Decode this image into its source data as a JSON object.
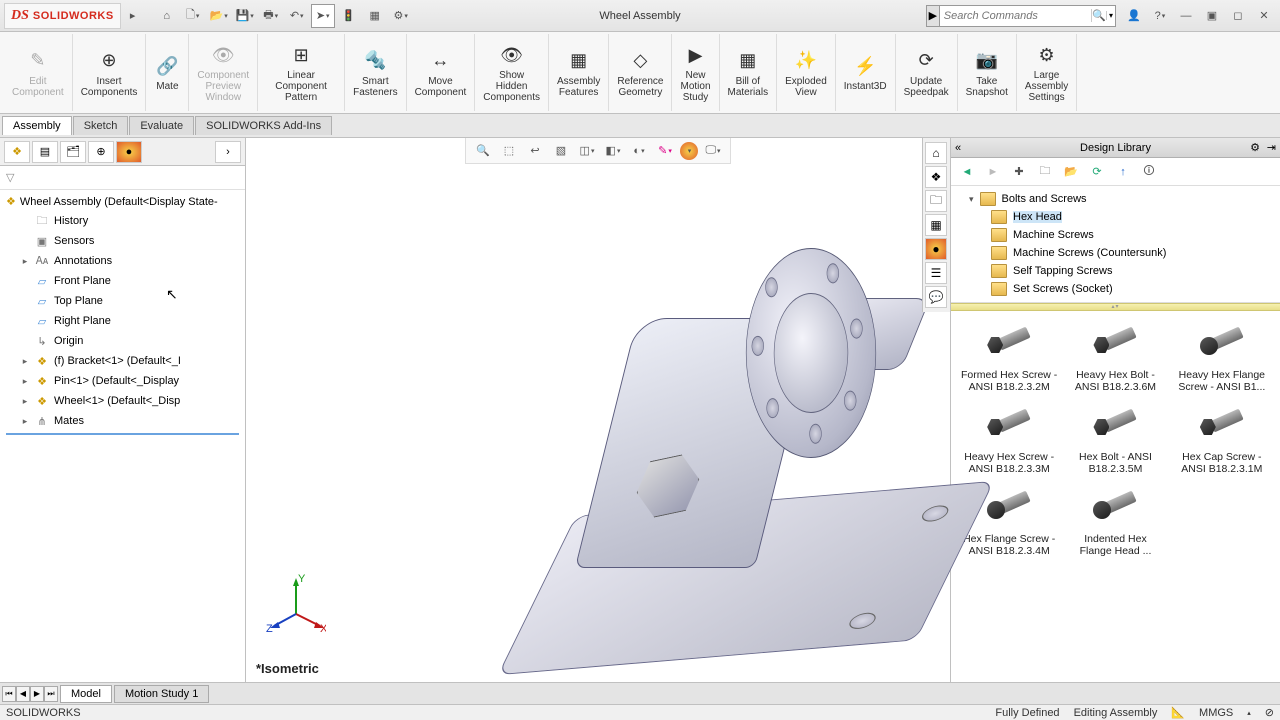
{
  "app": {
    "brand_ds": "DS",
    "brand_sw": "SOLIDWORKS",
    "doc_title": "Wheel Assembly"
  },
  "search": {
    "placeholder": "Search Commands"
  },
  "ribbon": [
    {
      "label": "Edit\nComponent",
      "dim": true
    },
    {
      "label": "Insert\nComponents"
    },
    {
      "label": "Mate"
    },
    {
      "label": "Component\nPreview\nWindow",
      "dim": true
    },
    {
      "label": "Linear Component\nPattern"
    },
    {
      "label": "Smart\nFasteners"
    },
    {
      "label": "Move\nComponent"
    },
    {
      "label": "Show\nHidden\nComponents"
    },
    {
      "label": "Assembly\nFeatures"
    },
    {
      "label": "Reference\nGeometry"
    },
    {
      "label": "New\nMotion\nStudy"
    },
    {
      "label": "Bill of\nMaterials"
    },
    {
      "label": "Exploded\nView"
    },
    {
      "label": "Instant3D"
    },
    {
      "label": "Update\nSpeedpak"
    },
    {
      "label": "Take\nSnapshot"
    },
    {
      "label": "Large\nAssembly\nSettings"
    }
  ],
  "doc_tabs": [
    "Assembly",
    "Sketch",
    "Evaluate",
    "SOLIDWORKS Add-Ins"
  ],
  "tree": {
    "root": "Wheel Assembly  (Default<Display State-",
    "items": [
      {
        "label": "History",
        "icon": "folder"
      },
      {
        "label": "Sensors",
        "icon": "sensor"
      },
      {
        "label": "Annotations",
        "icon": "note",
        "exp": true
      },
      {
        "label": "Front Plane",
        "icon": "plane"
      },
      {
        "label": "Top Plane",
        "icon": "plane"
      },
      {
        "label": "Right Plane",
        "icon": "plane"
      },
      {
        "label": "Origin",
        "icon": "origin"
      },
      {
        "label": "(f) Bracket<1> (Default<<Default>_I",
        "icon": "part",
        "exp": true
      },
      {
        "label": "Pin<1> (Default<<Default>_Display",
        "icon": "part",
        "exp": true
      },
      {
        "label": "Wheel<1> (Default<<Default>_Disp",
        "icon": "part",
        "exp": true
      },
      {
        "label": "Mates",
        "icon": "mates",
        "exp": true
      }
    ]
  },
  "orient_label": "*Isometric",
  "design_library": {
    "title": "Design Library",
    "parent": "Bolts and Screws",
    "folders": [
      "Hex Head",
      "Machine Screws",
      "Machine Screws (Countersunk)",
      "Self Tapping Screws",
      "Set Screws (Socket)"
    ],
    "selected": 0,
    "items": [
      {
        "label": "Formed Hex Screw - ANSI B18.2.3.2M"
      },
      {
        "label": "Heavy Hex Bolt - ANSI B18.2.3.6M"
      },
      {
        "label": "Heavy Hex Flange Screw - ANSI B1...",
        "flange": true
      },
      {
        "label": "Heavy Hex Screw - ANSI B18.2.3.3M"
      },
      {
        "label": "Hex Bolt - ANSI B18.2.3.5M"
      },
      {
        "label": "Hex Cap Screw - ANSI B18.2.3.1M"
      },
      {
        "label": "Hex Flange Screw - ANSI B18.2.3.4M",
        "flange": true
      },
      {
        "label": "Indented Hex Flange Head ...",
        "flange": true
      }
    ]
  },
  "bottom_tabs": [
    "Model",
    "Motion Study 1"
  ],
  "status": {
    "app": "SOLIDWORKS",
    "defined": "Fully Defined",
    "mode": "Editing Assembly",
    "units": "MMGS"
  }
}
